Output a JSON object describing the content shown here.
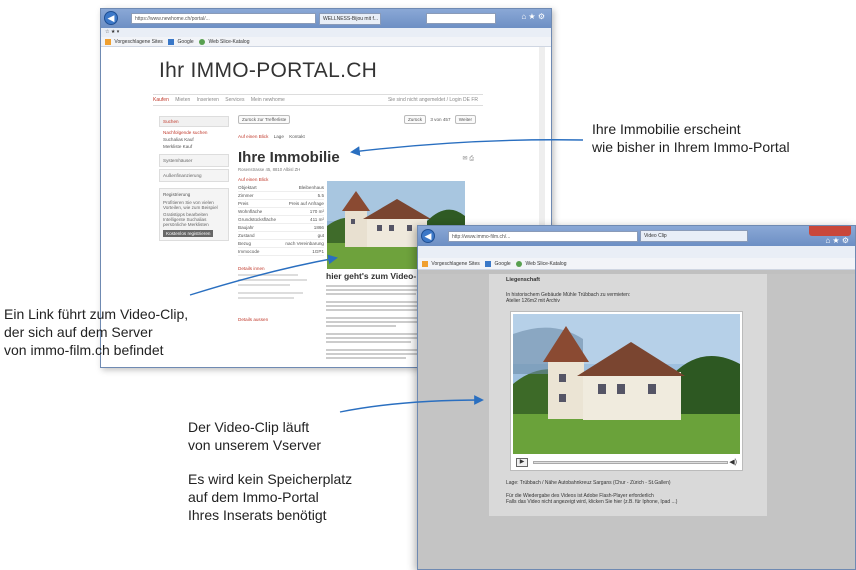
{
  "browser1": {
    "url": "https://www.newhome.ch/portal/...",
    "tab_label": "WELLNESS-Bijou mit f...",
    "menu": "☆ ★ ▾",
    "favorites": [
      "Vorgeschlagene Sites",
      "Google",
      "Web Slice-Katalog"
    ],
    "portal_title": "Ihr IMMO-PORTAL.CH",
    "nav": [
      "Kaufen",
      "Mieten",
      "Inserieren",
      "Services",
      "Mein newhome"
    ],
    "nav_right": "Sie sind nicht angemeldet / Login   DE  FR",
    "sidebar": {
      "search_head": "Suchen",
      "links": [
        "Nachfolgende suchen",
        "Suchalias Kauf",
        "Merkliste Kauf"
      ],
      "sections": [
        "Systemhäuser",
        "Außenfinanzierung"
      ],
      "reg_head": "Registrierung",
      "reg_text": "Profitieren Sie von vielen Vorteilen, wie zum Beispiel",
      "reg_items": [
        "Gratistipps bearbeiten",
        "Intelligente Suchalias",
        "persönliche Merklisten"
      ],
      "reg_button": "Kostenlos registrieren"
    },
    "main": {
      "back_button": "Zurück zur Trefferliste",
      "nav_pills": [
        "Zurück",
        "3 von 457",
        "Weiter"
      ],
      "tabs": [
        "Auf einen Blick",
        "Lage",
        "Kontakt"
      ],
      "title": "Ihre Immobilie",
      "subtitle": "Rosenstrasse 45, 8810 Albisl ZH",
      "facts_head": "Auf einen Blick",
      "facts": [
        {
          "k": "Objektart",
          "v": "Bleibenhaus"
        },
        {
          "k": "Zimmer",
          "v": "5.5"
        },
        {
          "k": "Preis",
          "v": "Preis auf Anfrage"
        },
        {
          "k": "Wohnfläche",
          "v": "170 m²"
        },
        {
          "k": "Grundstücksfläche",
          "v": "411 m²"
        },
        {
          "k": "Baujahr",
          "v": "1866"
        },
        {
          "k": "Zustand",
          "v": "gut"
        },
        {
          "k": "Bezug",
          "v": "nach Vereinbarung"
        },
        {
          "k": "Immocode",
          "v": "1GP1"
        }
      ],
      "details_head": "Details innen",
      "details_outer": "Details aussen",
      "video_link": "hier geht's zum Video-"
    }
  },
  "browser2": {
    "url": "http://www.immo-film.ch/...",
    "tab_label": "Video Clip",
    "favorites": [
      "Vorgeschlagene Sites",
      "Google",
      "Web Slice-Katalog"
    ],
    "heading": "Liegenschaft",
    "intro1": "In historischem Gebäude Mühle Trübbach zu vermieten:",
    "intro2": "Atelier 126m2 mit Archiv",
    "location": "Lage: Trübbach / Nähe Autobahnkreuz Sargans (Chur - Zürich - St.Gallen)",
    "footer1": "Für die Wiedergabe des Videos ist Adobe Flash-Player erforderlich",
    "footer2": "Falls das Video nicht angezeigt wird, klicken Sie hier (z.B. für Iphone, Ipad ...)"
  },
  "annotations": {
    "right_1": "Ihre Immobilie erscheint",
    "right_2": "wie bisher in Ihrem Immo-Portal",
    "left_1": "Ein Link führt zum Video-Clip,",
    "left_2": "der sich auf dem Server",
    "left_3": "von immo-film.ch befindet",
    "mid_1": "Der Video-Clip läuft",
    "mid_2": "von unserem Vserver",
    "mid_3": "Es wird kein Speicherplatz",
    "mid_4": "auf dem Immo-Portal",
    "mid_5": "Ihres Inserats benötigt"
  }
}
